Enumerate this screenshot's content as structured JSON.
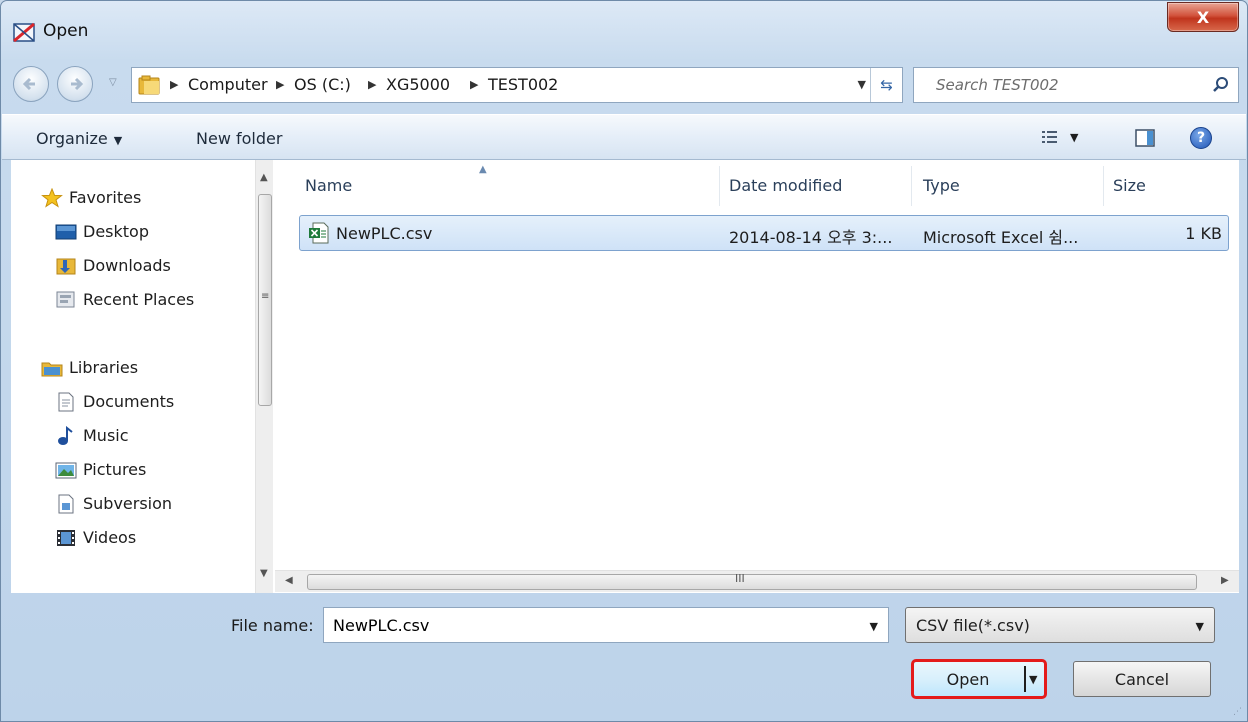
{
  "window": {
    "title": "Open",
    "close_label": "X"
  },
  "navbar": {
    "breadcrumbs": [
      "Computer",
      "OS (C:)",
      "XG5000",
      "TEST002"
    ],
    "search_placeholder": "Search TEST002"
  },
  "toolbar": {
    "organize_label": "Organize",
    "new_folder_label": "New folder"
  },
  "sidebar": {
    "favorites_label": "Favorites",
    "favorites": [
      "Desktop",
      "Downloads",
      "Recent Places"
    ],
    "libraries_label": "Libraries",
    "libraries": [
      "Documents",
      "Music",
      "Pictures",
      "Subversion",
      "Videos"
    ]
  },
  "columns": {
    "name": "Name",
    "date": "Date modified",
    "type": "Type",
    "size": "Size"
  },
  "files": [
    {
      "name": "NewPLC.csv",
      "date": "2014-08-14 오후 3:...",
      "type": "Microsoft Excel 쉼...",
      "size": "1 KB",
      "selected": true
    }
  ],
  "bottom": {
    "filename_label": "File name:",
    "filename_value": "NewPLC.csv",
    "filetype_value": "CSV file(*.csv)",
    "open_label": "Open",
    "cancel_label": "Cancel"
  },
  "colors": {
    "selection_border": "#7da2ce",
    "highlight_outline": "#e41b1b",
    "window_frame": "#c8dbee"
  }
}
